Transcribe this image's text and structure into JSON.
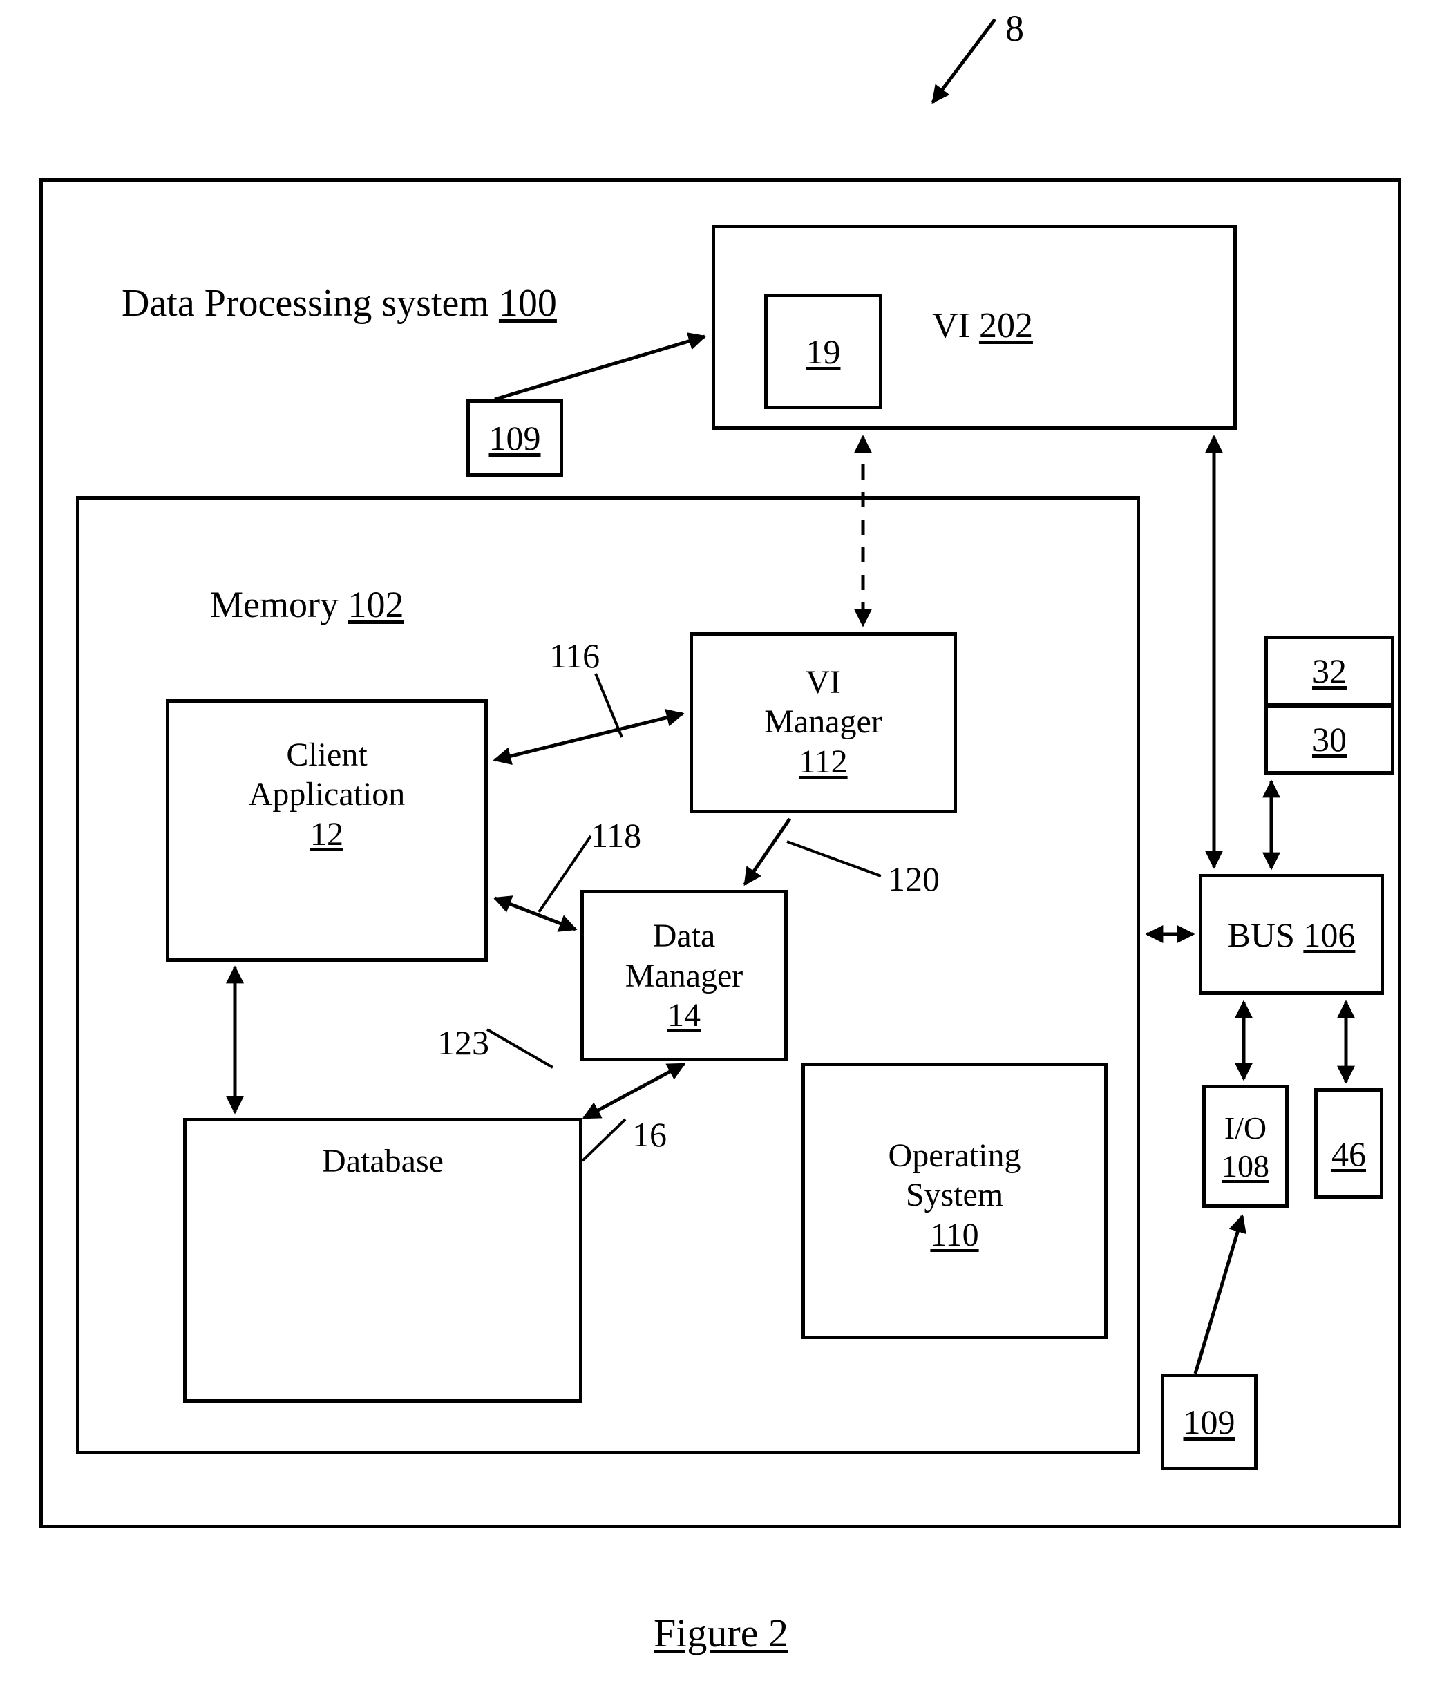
{
  "figure": {
    "caption": "Figure 2",
    "top_ref": "8"
  },
  "outer": {
    "title_text": "Data Processing system ",
    "title_ref": "100"
  },
  "vi_202": {
    "label_text": "VI ",
    "label_ref": "202",
    "inner_box_ref": "19"
  },
  "ref_109_top": "109",
  "ref_109_bottom": "109",
  "memory": {
    "title_text": "Memory ",
    "title_ref": "102"
  },
  "blocks": {
    "client_application": {
      "line1": "Client",
      "line2": "Application",
      "ref": "12"
    },
    "vi_manager": {
      "line1": "VI",
      "line2": "Manager",
      "ref": "112"
    },
    "data_manager": {
      "line1": "Data",
      "line2": "Manager",
      "ref": "14"
    },
    "database": {
      "line1": "Database",
      "ref": ""
    },
    "operating_system": {
      "line1": "Operating",
      "line2": "System",
      "ref": "110"
    },
    "bus": {
      "label_text": "BUS ",
      "ref": "106"
    },
    "io": {
      "line1": "I/O",
      "ref": "108"
    },
    "box_32": {
      "ref": "32"
    },
    "box_30": {
      "ref": "30"
    },
    "box_46": {
      "ref": "46"
    }
  },
  "connector_labels": {
    "l116": "116",
    "l118": "118",
    "l120": "120",
    "l123": "123",
    "l16": "16"
  },
  "colors": {
    "ink": "#000000",
    "paper": "#ffffff"
  }
}
